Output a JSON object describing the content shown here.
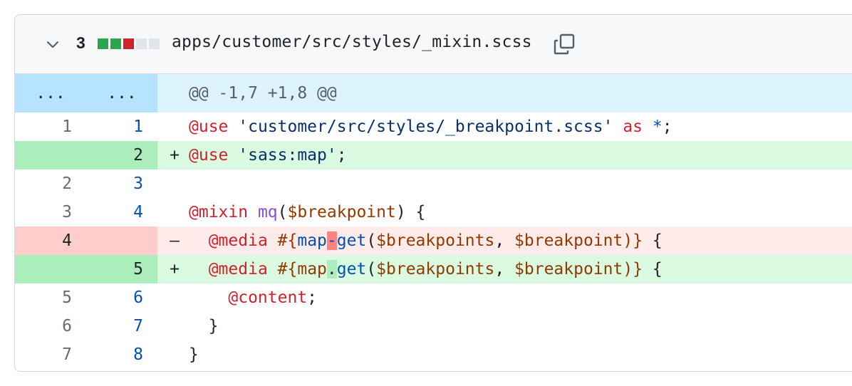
{
  "header": {
    "changes": "3",
    "diffstat": [
      "added",
      "added",
      "deleted",
      "neutral",
      "neutral"
    ],
    "file_path": "apps/customer/src/styles/_mixin.scss"
  },
  "hunk": {
    "left": "...",
    "right": "...",
    "text": "@@ -1,7 +1,8 @@"
  },
  "lines": [
    {
      "old": "1",
      "new": "1",
      "type": "context"
    },
    {
      "old": "",
      "new": "2",
      "type": "add",
      "marker": "+"
    },
    {
      "old": "2",
      "new": "3",
      "type": "context"
    },
    {
      "old": "3",
      "new": "4",
      "type": "context"
    },
    {
      "old": "4",
      "new": "",
      "type": "del",
      "marker": "–"
    },
    {
      "old": "",
      "new": "5",
      "type": "add",
      "marker": "+"
    },
    {
      "old": "5",
      "new": "6",
      "type": "context"
    },
    {
      "old": "6",
      "new": "7",
      "type": "context"
    },
    {
      "old": "7",
      "new": "8",
      "type": "context"
    }
  ],
  "code": {
    "l1": {
      "kw": "@use",
      "str": "'customer/src/styles/_breakpoint.scss'",
      "as": "as",
      "star": "*",
      "end": ";"
    },
    "l2": {
      "kw": "@use",
      "str": "'sass:map'",
      "end": ";"
    },
    "l4": {
      "kw": "@mixin",
      "fn": "mq",
      "open": "(",
      "var": "$breakpoint",
      "close": ") {"
    },
    "l5": {
      "kw": "@media",
      "interp": "#{",
      "a": "map",
      "sep": "-",
      "b": "get",
      "args_open": "(",
      "v1": "$breakpoints",
      "comma": ", ",
      "v2": "$breakpoint",
      "args_close": ")}",
      "end": " {"
    },
    "l6": {
      "kw": "@media",
      "interp": "#{",
      "a": "map",
      "sep": ".",
      "b": "get",
      "args_open": "(",
      "v1": "$breakpoints",
      "comma": ", ",
      "v2": "$breakpoint",
      "args_close": ")}",
      "end": " {"
    },
    "l7": {
      "kw": "@content",
      "end": ";"
    },
    "l8": {
      "text": "}"
    },
    "l9": {
      "text": "}"
    }
  },
  "colors": {
    "added": "#2da44e",
    "deleted": "#cf222e",
    "neutral": "#d0d7de"
  }
}
